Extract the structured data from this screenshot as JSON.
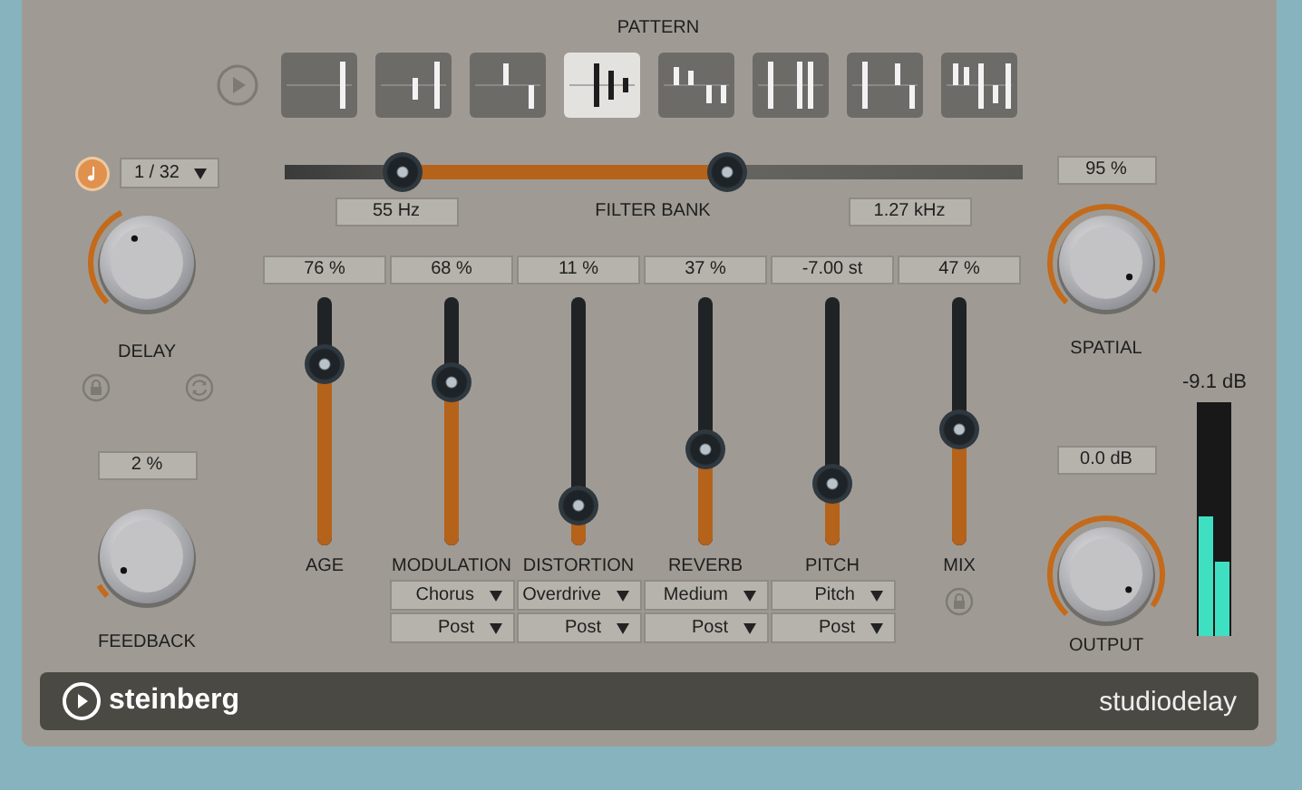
{
  "pattern": {
    "title": "PATTERN",
    "items": [
      {
        "selected": false
      },
      {
        "selected": false
      },
      {
        "selected": false
      },
      {
        "selected": true
      },
      {
        "selected": false
      },
      {
        "selected": false
      },
      {
        "selected": false
      },
      {
        "selected": false
      }
    ]
  },
  "delay": {
    "tempo_sync": {
      "on": true
    },
    "note_value": "1 / 32",
    "label": "DELAY"
  },
  "feedback": {
    "value": "2 %",
    "label": "FEEDBACK"
  },
  "filter_bank": {
    "label": "FILTER BANK",
    "low": {
      "value": "55 Hz"
    },
    "high": {
      "value": "1.27 kHz"
    }
  },
  "faders": [
    {
      "kind": "plain",
      "label": "AGE",
      "value": "76 %",
      "level": 0.73
    },
    {
      "kind": "effect",
      "label": "MODULATION",
      "value": "68 %",
      "level": 0.66,
      "type": "Chorus",
      "position": "Post"
    },
    {
      "kind": "effect",
      "label": "DISTORTION",
      "value": "11 %",
      "level": 0.16,
      "type": "Overdrive",
      "position": "Post"
    },
    {
      "kind": "effect",
      "label": "REVERB",
      "value": "37 %",
      "level": 0.39,
      "type": "Medium",
      "position": "Post"
    },
    {
      "kind": "effect",
      "label": "PITCH",
      "value": "-7.00 st",
      "level": 0.25,
      "type": "Pitch",
      "position": "Post"
    },
    {
      "kind": "mix",
      "label": "MIX",
      "value": "47 %",
      "level": 0.47
    }
  ],
  "spatial": {
    "value": "95 %",
    "label": "SPATIAL"
  },
  "output": {
    "value": "0.0 dB",
    "label": "OUTPUT",
    "meter": {
      "reading": "-9.1 dB",
      "channels": [
        {
          "level": 0.51
        },
        {
          "level": 0.32
        }
      ]
    }
  },
  "footer": {
    "brand": "steinberg",
    "product": "studiodelay"
  }
}
